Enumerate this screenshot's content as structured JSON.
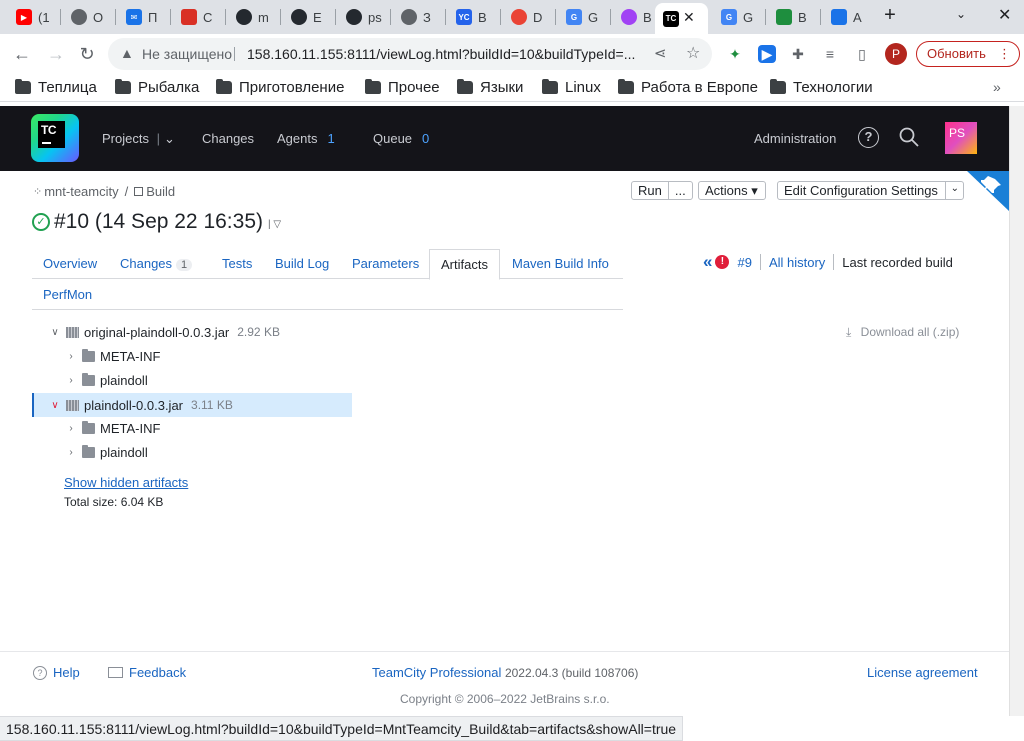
{
  "browser": {
    "tabs": [
      {
        "label": "(1",
        "color": "#ff0000"
      },
      {
        "label": "O",
        "color": "#5f6368"
      },
      {
        "label": "П",
        "color": "#1a73e8"
      },
      {
        "label": "C",
        "color": "#d93025"
      },
      {
        "label": "m",
        "color": "#24292f"
      },
      {
        "label": "E",
        "color": "#24292f"
      },
      {
        "label": "ps",
        "color": "#24292f"
      },
      {
        "label": "З",
        "color": "#5f6368"
      },
      {
        "label": "В",
        "color": "#2563eb"
      },
      {
        "label": "D",
        "color": "#ea4335"
      },
      {
        "label": "G",
        "color": "#4285f4"
      },
      {
        "label": "В",
        "color": "#a142f4"
      },
      {
        "label": "",
        "color": "#000000"
      },
      {
        "label": "G",
        "color": "#4285f4"
      },
      {
        "label": "B",
        "color": "#1e8e3e"
      },
      {
        "label": "A",
        "color": "#1a73e8"
      }
    ],
    "not_secure": "Не защищено",
    "url": "158.160.11.155:8111/viewLog.html?buildId=10&buildTypeId=...",
    "profile_initial": "P",
    "update_label": "Обновить",
    "bookmarks": [
      "Теплица",
      "Рыбалка",
      "Приготовление",
      "Прочее",
      "Языки",
      "Linux",
      "Работа в Европе",
      "Технологии"
    ],
    "status_url": "158.160.11.155:8111/viewLog.html?buildId=10&buildTypeId=MntTeamcity_Build&tab=artifacts&showAll=true"
  },
  "tc": {
    "logo_text": "TC",
    "nav": {
      "projects": "Projects",
      "changes": "Changes",
      "agents": "Agents",
      "agents_count": "1",
      "queue": "Queue",
      "queue_count": "0",
      "administration": "Administration"
    },
    "avatar_initials": "PS"
  },
  "page": {
    "breadcrumb": {
      "project": "mnt-teamcity",
      "sep": "/",
      "build_config": "Build"
    },
    "buttons": {
      "run": "Run",
      "run_more": "...",
      "actions": "Actions ▾",
      "edit": "Edit Configuration Settings"
    },
    "build_title": "#10 (14 Sep 22 16:35)",
    "tabs": [
      {
        "label": "Overview"
      },
      {
        "label": "Changes",
        "count": "1"
      },
      {
        "label": "Tests"
      },
      {
        "label": "Build Log"
      },
      {
        "label": "Parameters"
      },
      {
        "label": "Artifacts",
        "active": true
      },
      {
        "label": "Maven Build Info"
      },
      {
        "label": "PerfMon"
      }
    ],
    "history": {
      "prev_build": "#9",
      "all_history": "All history",
      "last_recorded": "Last recorded build"
    },
    "download_all": "Download all (.zip)",
    "artifacts": [
      {
        "name": "original-plaindoll-0.0.3.jar",
        "size": "2.92 KB",
        "children": [
          "META-INF",
          "plaindoll"
        ]
      },
      {
        "name": "plaindoll-0.0.3.jar",
        "size": "3.11 KB",
        "children": [
          "META-INF",
          "plaindoll"
        ]
      }
    ],
    "show_hidden": "Show hidden artifacts",
    "total_size": "Total size: 6.04 KB"
  },
  "footer": {
    "help": "Help",
    "feedback": "Feedback",
    "product": "TeamCity Professional",
    "version": "2022.04.3 (build 108706)",
    "license": "License agreement",
    "copyright": "Copyright © 2006–2022 JetBrains s.r.o."
  }
}
